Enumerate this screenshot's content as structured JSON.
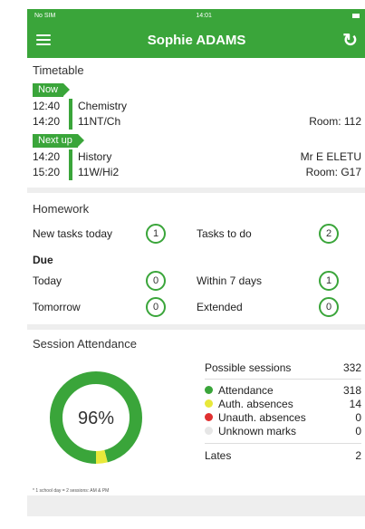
{
  "status": {
    "carrier": "No SIM",
    "time": "14:01"
  },
  "header": {
    "title": "Sophie ADAMS"
  },
  "timetable": {
    "title": "Timetable",
    "now_label": "Now",
    "next_label": "Next up",
    "now": {
      "start": "12:40",
      "end": "14:20",
      "subject": "Chemistry",
      "group": "11NT/Ch",
      "teacher": "",
      "room": "Room: 112"
    },
    "next": {
      "start": "14:20",
      "end": "15:20",
      "subject": "History",
      "group": "11W/Hi2",
      "teacher": "Mr E ELETU",
      "room": "Room: G17"
    }
  },
  "homework": {
    "title": "Homework",
    "new_tasks_label": "New tasks today",
    "new_tasks": "1",
    "tasks_to_do_label": "Tasks to do",
    "tasks_to_do": "2",
    "due_label": "Due",
    "today_label": "Today",
    "today": "0",
    "within7_label": "Within 7 days",
    "within7": "1",
    "tomorrow_label": "Tomorrow",
    "tomorrow": "0",
    "extended_label": "Extended",
    "extended": "0"
  },
  "attendance": {
    "title": "Session Attendance",
    "percent": "96%",
    "possible_label": "Possible sessions",
    "possible": "332",
    "attendance_label": "Attendance",
    "attendance": "318",
    "auth_label": "Auth. absences",
    "auth": "14",
    "unauth_label": "Unauth. absences",
    "unauth": "0",
    "unknown_label": "Unknown marks",
    "unknown": "0",
    "lates_label": "Lates",
    "lates": "2",
    "footnote": "* 1 school day = 2 sessions: AM & PM"
  },
  "colors": {
    "brand": "#3aa53a",
    "attendance": "#3aa53a",
    "auth": "#e8e83a",
    "unauth": "#e03030",
    "unknown": "#e6e6e6"
  },
  "chart_data": {
    "type": "pie",
    "categories": [
      "Attendance",
      "Auth. absences",
      "Unauth. absences",
      "Unknown marks"
    ],
    "values": [
      318,
      14,
      0,
      0
    ],
    "title": "Session Attendance"
  }
}
